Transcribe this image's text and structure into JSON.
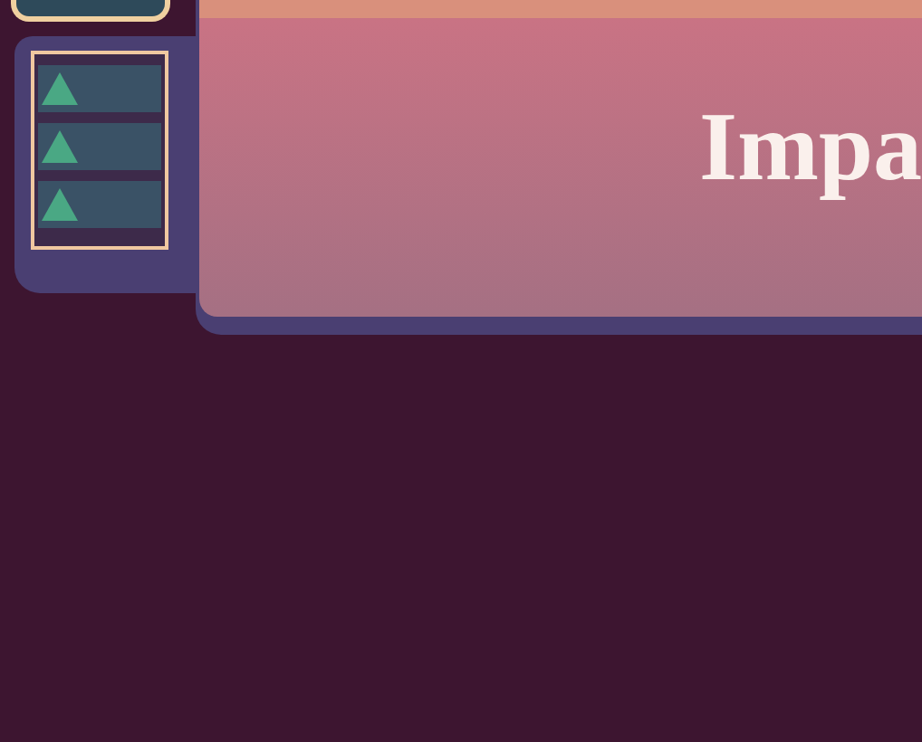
{
  "banner": {
    "title": "Impa"
  }
}
